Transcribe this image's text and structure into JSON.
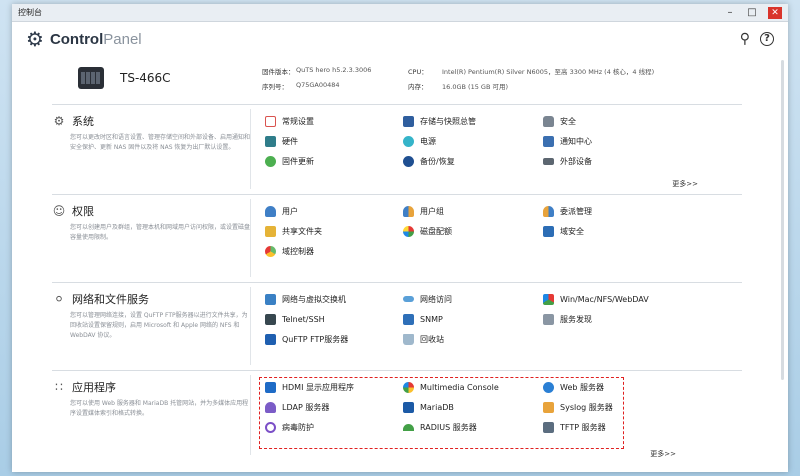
{
  "window": {
    "title": "控制台"
  },
  "header": {
    "brand_bold": "Control",
    "brand_light": "Panel"
  },
  "device": {
    "name": "TS-466C",
    "firmware_label": "固件版本：",
    "firmware_value": "QuTS hero h5.2.3.3006",
    "serial_label": "序列号：",
    "serial_value": "Q75GA00484",
    "cpu_label": "CPU：",
    "cpu_value": "Intel(R) Pentium(R) Silver N6005，至高 3300 MHz (4 核心，4 线程)",
    "memory_label": "内存：",
    "memory_value": "16.0GB (15 GB 可用)"
  },
  "sections": [
    {
      "title": "系统",
      "desc": "您可以更改时区和语言设置、管理存储空间和外部设备、启用通知和安全保护、更新 NAS 固件以及将 NAS 恢复为出厂默认设置。",
      "items": [
        "常规设置",
        "存储与快照总管",
        "安全",
        "硬件",
        "电源",
        "通知中心",
        "固件更新",
        "备份/恢复",
        "外部设备"
      ],
      "more": "更多>>"
    },
    {
      "title": "权限",
      "desc": "您可以创建用户及群组，管理本机和网域用户访问权限，或设置磁盘容量使用限制。",
      "items": [
        "用户",
        "用户组",
        "委派管理",
        "共享文件夹",
        "磁盘配额",
        "域安全",
        "域控制器"
      ]
    },
    {
      "title": "网络和文件服务",
      "desc": "您可以管理网络连接，设置 QuFTP FTP服务器以进行文件共享，为回收站设置保留规则，启用 Microsoft 和 Apple 网络的 NFS 和 WebDAV 协议。",
      "items": [
        "网络与虚拟交换机",
        "网络访问",
        "Win/Mac/NFS/WebDAV",
        "Telnet/SSH",
        "SNMP",
        "服务发现",
        "QuFTP FTP服务器",
        "回收站"
      ]
    },
    {
      "title": "应用程序",
      "desc": "您可以使用 Web 服务器和 MariaDB 托管网站，并为多媒体应用程序设置媒体索引和格式转换。",
      "items": [
        "HDMI 显示应用程序",
        "Multimedia Console",
        "Web 服务器",
        "LDAP 服务器",
        "MariaDB",
        "Syslog 服务器",
        "病毒防护",
        "RADIUS 服务器",
        "TFTP 服务器"
      ],
      "more": "更多>>"
    }
  ],
  "colors": {
    "highlight_border": "#e02020",
    "brand_dark": "#2b3644"
  }
}
